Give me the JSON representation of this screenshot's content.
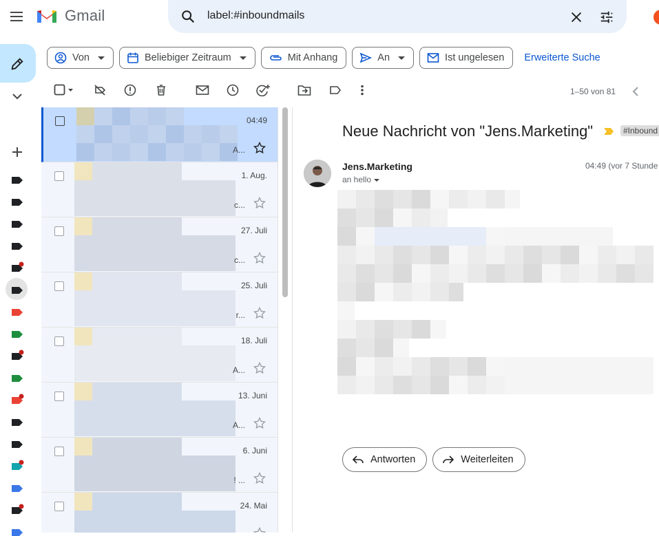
{
  "app": {
    "logo_text": "Gmail"
  },
  "search": {
    "query": "label:#inboundmails"
  },
  "filters": {
    "chips": [
      {
        "label": "Von",
        "icon": "contact-icon",
        "dropdown": true
      },
      {
        "label": "Beliebiger Zeitraum",
        "icon": "calendar-icon",
        "dropdown": true
      },
      {
        "label": "Mit Anhang",
        "icon": "attachment-icon",
        "dropdown": false
      },
      {
        "label": "An",
        "icon": "send-icon",
        "dropdown": true
      },
      {
        "label": "Ist ungelesen",
        "icon": "mail-icon",
        "dropdown": false
      }
    ],
    "advanced_label": "Erweiterte Suche"
  },
  "toolbar": {
    "count": "1–50 von 81"
  },
  "mail_list": {
    "rows": [
      {
        "date": "04:49",
        "snippet": "A...",
        "selected": true
      },
      {
        "date": "1. Aug.",
        "snippet": "c...",
        "selected": false
      },
      {
        "date": "27. Juli",
        "snippet": "c...",
        "selected": false
      },
      {
        "date": "25. Juli",
        "snippet": "r...",
        "selected": false
      },
      {
        "date": "18. Juli",
        "snippet": "A...",
        "selected": false
      },
      {
        "date": "13. Juni",
        "snippet": "A...",
        "selected": false
      },
      {
        "date": "6. Juni",
        "snippet": "! ...",
        "selected": false
      },
      {
        "date": "24. Mai",
        "snippet": "",
        "selected": false
      }
    ]
  },
  "message": {
    "subject": "Neue Nachricht von \"Jens.Marketing\"",
    "label_tag": "#Inbound",
    "sender": "Jens.Marketing",
    "recipient": "an hello",
    "time": "04:49 (vor 7 Stunde",
    "reply_label": "Antworten",
    "forward_label": "Weiterleiten"
  },
  "colors": {
    "accent": "#0b57d0",
    "selected_row": "#c2dbff",
    "list_bg": "#f2f6fc",
    "compose_bg": "#c2e7ff"
  }
}
